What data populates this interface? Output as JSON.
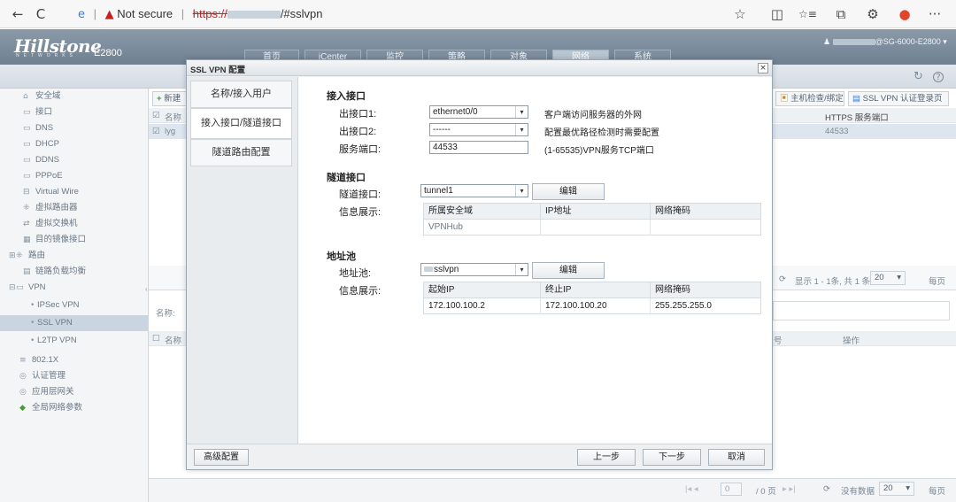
{
  "browser": {
    "security_label": "Not secure",
    "url_scheme": "https://",
    "url_path": "/#sslvpn",
    "buttons": {
      "back": "←",
      "reload": "C",
      "star": "☆",
      "split": "◫",
      "favorites": "☆≡",
      "collections": "⧉",
      "extensions": "⚙",
      "more": "···"
    }
  },
  "app": {
    "logo": "Hillstone",
    "logo_sub": "NETWORKS",
    "model": "E2800",
    "user": "@SG-6000-E2800",
    "topnav": [
      "首页",
      "iCenter",
      "监控",
      "策略",
      "对象",
      "网络",
      "系统"
    ],
    "toolbar_icons": {
      "refresh": "↻",
      "help": "?"
    }
  },
  "sidebar": {
    "items": [
      {
        "label": "安全域",
        "icon": "⌂"
      },
      {
        "label": "接口",
        "icon": "▭"
      },
      {
        "label": "DNS",
        "icon": "▭"
      },
      {
        "label": "DHCP",
        "icon": "▭"
      },
      {
        "label": "DDNS",
        "icon": "▭"
      },
      {
        "label": "PPPoE",
        "icon": "▭"
      },
      {
        "label": "Virtual Wire",
        "icon": "⊟"
      },
      {
        "label": "虚拟路由器",
        "icon": "⁜"
      },
      {
        "label": "虚拟交换机",
        "icon": "⇄"
      },
      {
        "label": "目的镜像接口",
        "icon": "▦"
      },
      {
        "label": "路由",
        "icon": "⁜"
      },
      {
        "label": "链路负载均衡",
        "icon": "▤"
      },
      {
        "label": "VPN",
        "icon": "▭"
      },
      {
        "label": "IPSec VPN",
        "icon": "•"
      },
      {
        "label": "SSL VPN",
        "icon": "•"
      },
      {
        "label": "L2TP VPN",
        "icon": "•"
      },
      {
        "label": "802.1X",
        "icon": "≡"
      },
      {
        "label": "认证管理",
        "icon": "◎"
      },
      {
        "label": "应用层网关",
        "icon": "◎"
      },
      {
        "label": "全局网络参数",
        "icon": "◆"
      }
    ]
  },
  "background": {
    "new_button": "新建",
    "col_name": "名称",
    "row_name": "lyg",
    "host_check_button": "主机检查/绑定",
    "ssl_login_button": "SSL VPN 认证登录页",
    "https_port_header": "HTTPS 服务端口",
    "https_port_value": "44533",
    "paging_text": "显示 1 - 1条, 共 1 条",
    "page_size": "20",
    "per_page": "每页",
    "name_label": "名称:",
    "col_name2": "名称",
    "col_no": "号",
    "col_ops": "操作",
    "page_input": "0",
    "page_total": "/ 0 页",
    "no_data": "没有数据",
    "page_size2": "20",
    "per_page2": "每页"
  },
  "modal": {
    "title": "SSL VPN 配置",
    "close": "×",
    "tabs": [
      "名称/接入用户",
      "接入接口/隧道接口",
      "隧道路由配置"
    ],
    "access": {
      "section": "接入接口",
      "out1_label": "出接口1:",
      "out1_value": "ethernet0/0",
      "out1_hint": "客户端访问服务器的外网",
      "out2_label": "出接口2:",
      "out2_value": "------",
      "out2_hint": "配置最优路径检测时需要配置",
      "port_label": "服务端口:",
      "port_value": "44533",
      "port_hint": "(1-65535)VPN服务TCP端口"
    },
    "tunnel": {
      "section": "隧道接口",
      "if_label": "隧道接口:",
      "if_value": "tunnel1",
      "edit_button": "编辑",
      "info_label": "信息展示:",
      "headers": [
        "所属安全域",
        "IP地址",
        "网络掩码"
      ],
      "row": [
        "VPNHub",
        "",
        ""
      ]
    },
    "pool": {
      "section": "地址池",
      "pool_label": "地址池:",
      "pool_value": "sslvpn",
      "edit_button": "编辑",
      "info_label": "信息展示:",
      "headers": [
        "起始IP",
        "终止IP",
        "网络掩码"
      ],
      "row": [
        "172.100.100.2",
        "172.100.100.20",
        "255.255.255.0"
      ]
    },
    "footer": {
      "advanced": "高级配置",
      "prev": "上一步",
      "next": "下一步",
      "cancel": "取消"
    }
  }
}
